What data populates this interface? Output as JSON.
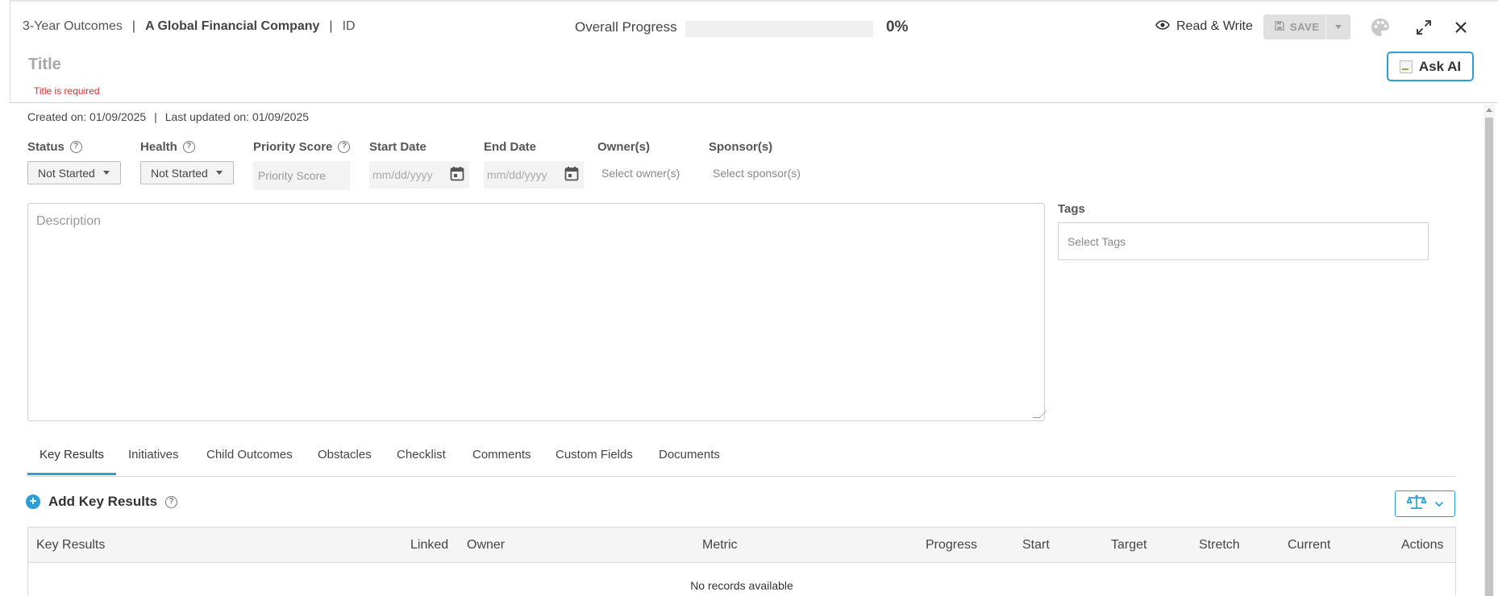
{
  "header": {
    "breadcrumb": {
      "parent": "3-Year Outcomes",
      "separator": "|",
      "company": "A Global Financial Company",
      "id": "ID"
    },
    "progress": {
      "label": "Overall Progress",
      "value": 0,
      "display": "0%"
    },
    "access_mode": "Read & Write",
    "save_label": "SAVE",
    "title_placeholder": "Title",
    "title_error": "Title is required",
    "ask_ai_label": "Ask AI",
    "icons": [
      "eye-icon",
      "save-icon",
      "chevron-down-icon",
      "palette-icon",
      "expand-icon",
      "close-icon"
    ]
  },
  "meta": {
    "created": "Created on: 01/09/2025",
    "separator": "|",
    "updated": "Last updated on: 01/09/2025"
  },
  "fields": {
    "status": {
      "label": "Status",
      "value": "Not Started"
    },
    "health": {
      "label": "Health",
      "value": "Not Started"
    },
    "priority": {
      "label": "Priority Score",
      "placeholder": "Priority Score"
    },
    "start_date": {
      "label": "Start Date",
      "placeholder": "mm/dd/yyyy"
    },
    "end_date": {
      "label": "End Date",
      "placeholder": "mm/dd/yyyy"
    },
    "owners": {
      "label": "Owner(s)",
      "placeholder": "Select owner(s)"
    },
    "sponsors": {
      "label": "Sponsor(s)",
      "placeholder": "Select sponsor(s)"
    },
    "description_placeholder": "Description",
    "tags": {
      "label": "Tags",
      "placeholder": "Select Tags"
    }
  },
  "tabs": [
    "Key Results",
    "Initiatives",
    "Child Outcomes",
    "Obstacles",
    "Checklist",
    "Comments",
    "Custom Fields",
    "Documents"
  ],
  "active_tab": "Key Results",
  "key_results": {
    "add_label": "Add Key Results",
    "columns": [
      "Key Results",
      "Linked",
      "Owner",
      "Metric",
      "Progress",
      "Start",
      "Target",
      "Stretch",
      "Current",
      "Actions"
    ],
    "empty_text": "No records available"
  },
  "colors": {
    "accent": "#2a9fd6",
    "error": "#d32f2f"
  }
}
